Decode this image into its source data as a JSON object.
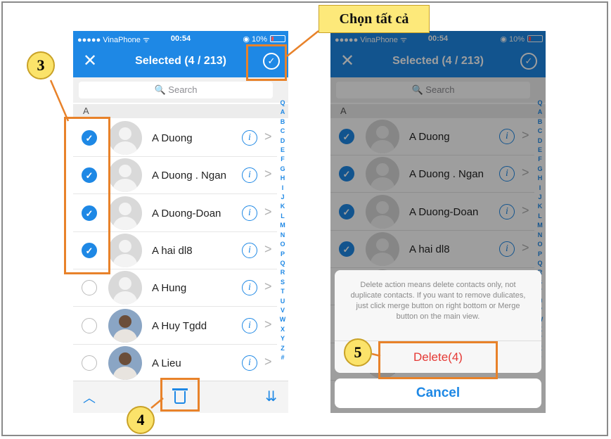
{
  "status": {
    "carrier": "●●●●● VinaPhone ᯤ",
    "time": "00:54",
    "battery": "◉ 10%"
  },
  "nav": {
    "close": "✕",
    "title": "Selected (4 / 213)",
    "check": "✓"
  },
  "search": {
    "placeholder": "🔍 Search"
  },
  "section": "A",
  "contacts": [
    {
      "name": "A Duong",
      "checked": true
    },
    {
      "name": "A Duong . Ngan",
      "checked": true
    },
    {
      "name": "A Duong-Doan",
      "checked": true
    },
    {
      "name": "A hai dl8",
      "checked": true
    },
    {
      "name": "A Hung",
      "checked": false
    },
    {
      "name": "A Huy Tgdd",
      "checked": false
    },
    {
      "name": "A Lieu",
      "checked": false
    }
  ],
  "index_letters": [
    "Q",
    "A",
    "B",
    "C",
    "D",
    "E",
    "F",
    "G",
    "H",
    "I",
    "J",
    "K",
    "L",
    "M",
    "N",
    "O",
    "P",
    "Q",
    "R",
    "S",
    "T",
    "U",
    "V",
    "W",
    "X",
    "Y",
    "Z",
    "#"
  ],
  "info_glyph": "i",
  "chevron": ">",
  "check_glyph": "✓",
  "toolbar": {
    "up": "︿",
    "merge": "⇊"
  },
  "dialog": {
    "message": "Delete action means delete contacts only, not duplicate contacts. If you want to remove dulicates, just click merge button on right bottom or Merge button on the main view.",
    "delete_label": "Delete(4)",
    "cancel_label": "Cancel"
  },
  "annotations": {
    "callout": "Chọn tất cả",
    "badge_3": "3",
    "badge_4": "4",
    "badge_5": "5"
  },
  "colors": {
    "accent": "#1e88e5",
    "highlight": "#e8822a",
    "badge": "#fbe36a",
    "danger": "#e53935"
  }
}
